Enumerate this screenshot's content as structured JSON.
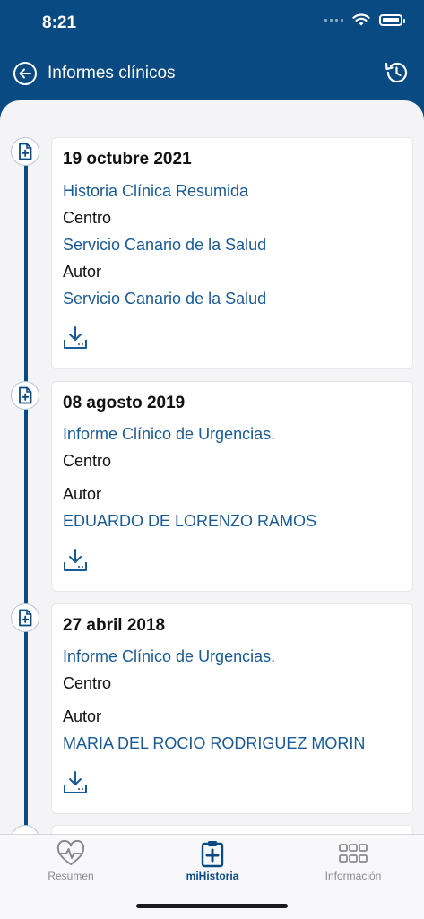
{
  "status_bar": {
    "time": "8:21"
  },
  "header": {
    "title": "Informes clínicos"
  },
  "reports": [
    {
      "date": "19 octubre 2021",
      "type": "Historia Clínica Resumida",
      "centro_label": "Centro",
      "centro": "Servicio Canario de la Salud",
      "autor_label": "Autor",
      "autor": "Servicio Canario de la Salud"
    },
    {
      "date": "08 agosto 2019",
      "type": "Informe Clínico de Urgencias.",
      "centro_label": "Centro",
      "centro": "",
      "autor_label": "Autor",
      "autor": "EDUARDO DE LORENZO RAMOS"
    },
    {
      "date": "27 abril 2018",
      "type": "Informe Clínico de Urgencias.",
      "centro_label": "Centro",
      "centro": "",
      "autor_label": "Autor",
      "autor": "MARIA DEL ROCIO RODRIGUEZ MORIN"
    }
  ],
  "tabs": [
    {
      "label": "Resumen",
      "icon": "heart-pulse-icon",
      "active": false
    },
    {
      "label": "miHistoria",
      "icon": "clipboard-plus-icon",
      "active": true
    },
    {
      "label": "Información",
      "icon": "grid-icon",
      "active": false
    }
  ],
  "colors": {
    "primary": "#0a4a82",
    "link": "#1a5a94",
    "background": "#f4f4f6"
  }
}
